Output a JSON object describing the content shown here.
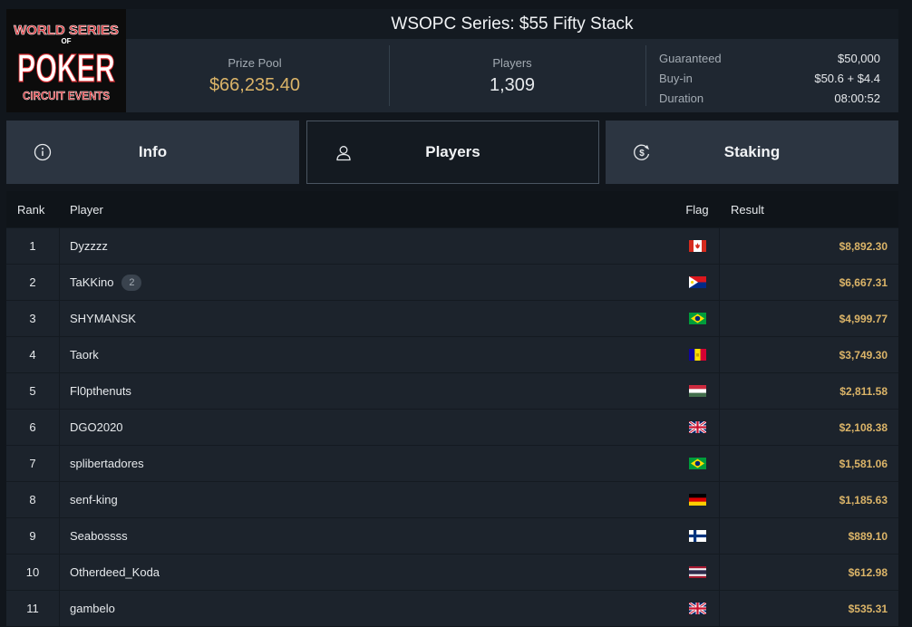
{
  "logo": {
    "line1": "WORLD SERIES",
    "line2": "OF",
    "line3": "POKER",
    "line4": "CIRCUIT EVENTS"
  },
  "title": "WSOPC Series: $55 Fifty Stack",
  "stats": {
    "prize_pool_label": "Prize Pool",
    "prize_pool_value": "$66,235.40",
    "players_label": "Players",
    "players_value": "1,309"
  },
  "details": [
    {
      "key": "Guaranteed",
      "value": "$50,000"
    },
    {
      "key": "Buy-in",
      "value": "$50.6 + $4.4"
    },
    {
      "key": "Duration",
      "value": "08:00:52"
    }
  ],
  "tabs": [
    {
      "label": "Info",
      "icon": "info-icon"
    },
    {
      "label": "Players",
      "icon": "user-icon"
    },
    {
      "label": "Staking",
      "icon": "dollar-cycle-icon"
    }
  ],
  "active_tab": "Players",
  "table": {
    "headers": {
      "rank": "Rank",
      "player": "Player",
      "flag": "Flag",
      "result": "Result"
    },
    "rows": [
      {
        "rank": "1",
        "player": "Dyzzzz",
        "badge": "",
        "flag": "canada",
        "result": "$8,892.30"
      },
      {
        "rank": "2",
        "player": "TaKKino",
        "badge": "2",
        "flag": "sint-maarten",
        "result": "$6,667.31"
      },
      {
        "rank": "3",
        "player": "SHYMANSK",
        "badge": "",
        "flag": "brazil",
        "result": "$4,999.77"
      },
      {
        "rank": "4",
        "player": "Taork",
        "badge": "",
        "flag": "andorra",
        "result": "$3,749.30"
      },
      {
        "rank": "5",
        "player": "Fl0pthenuts",
        "badge": "",
        "flag": "hungary",
        "result": "$2,811.58"
      },
      {
        "rank": "6",
        "player": "DGO2020",
        "badge": "",
        "flag": "united-kingdom",
        "result": "$2,108.38"
      },
      {
        "rank": "7",
        "player": "splibertadores",
        "badge": "",
        "flag": "brazil",
        "result": "$1,581.06"
      },
      {
        "rank": "8",
        "player": "senf-king",
        "badge": "",
        "flag": "germany",
        "result": "$1,185.63"
      },
      {
        "rank": "9",
        "player": "Seabossss",
        "badge": "",
        "flag": "finland",
        "result": "$889.10"
      },
      {
        "rank": "10",
        "player": "Otherdeed_Koda",
        "badge": "",
        "flag": "thailand",
        "result": "$612.98"
      },
      {
        "rank": "11",
        "player": "gambelo",
        "badge": "",
        "flag": "united-kingdom",
        "result": "$535.31"
      }
    ]
  },
  "colors": {
    "accent_gold": "#dbb468",
    "bg": "#11161c",
    "panel": "#1f2731"
  }
}
